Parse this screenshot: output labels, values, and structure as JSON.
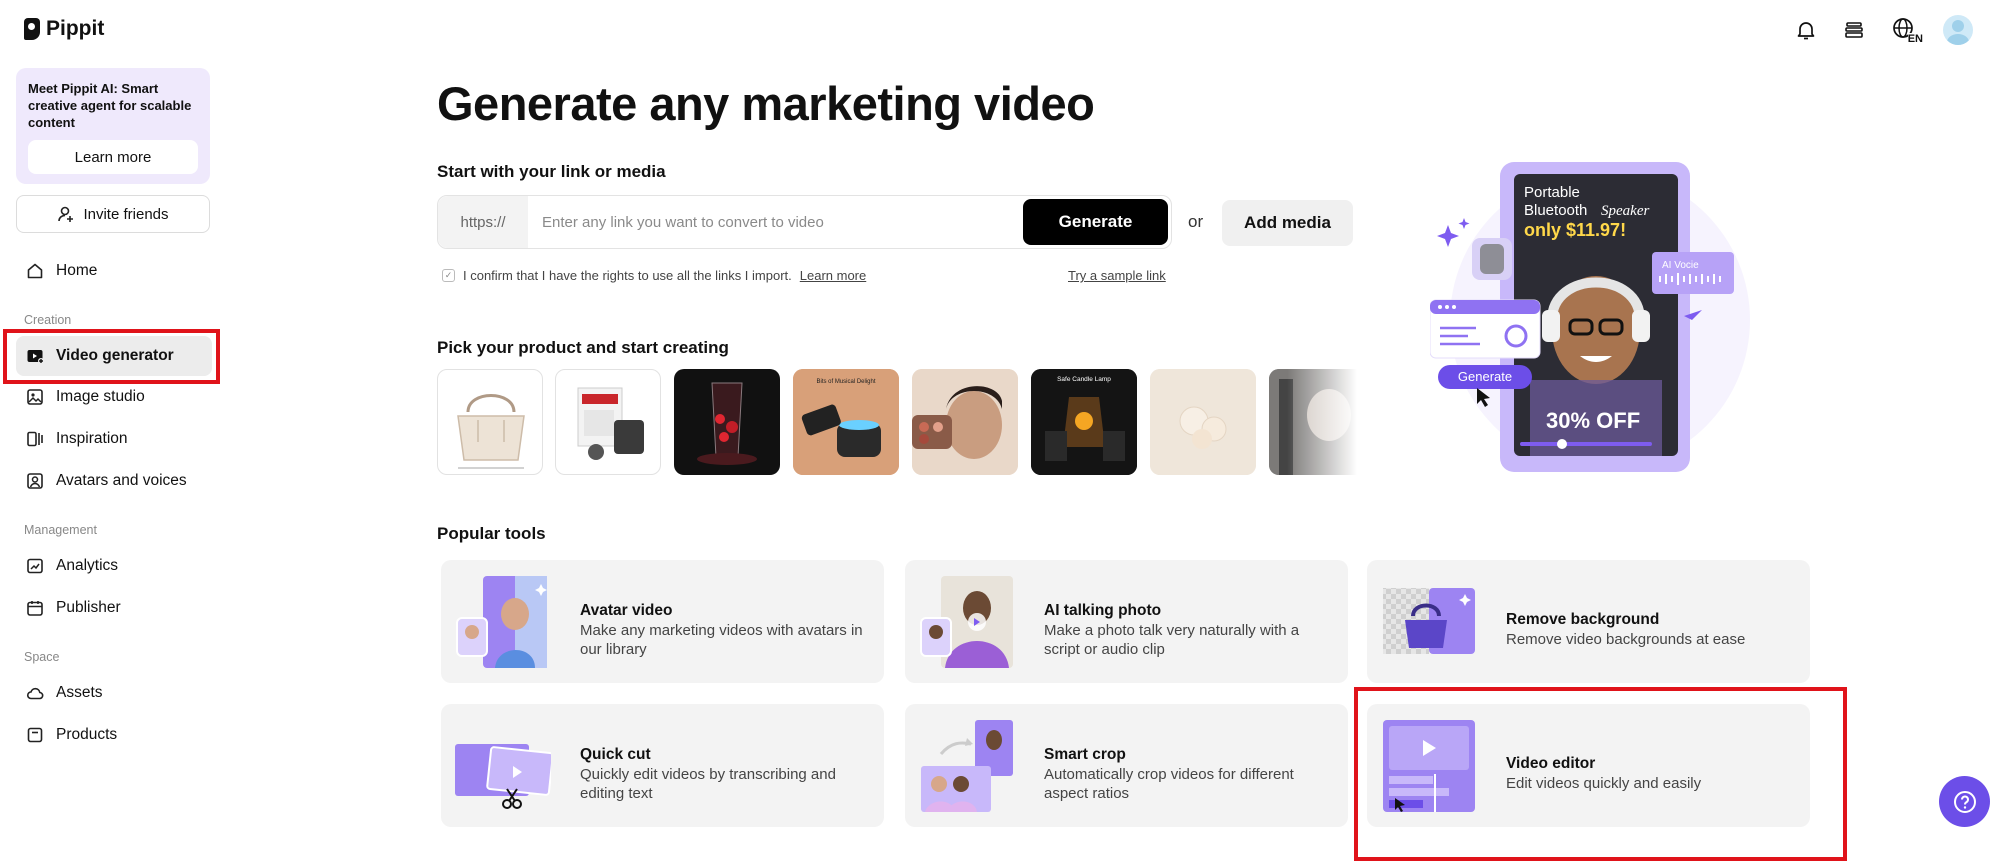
{
  "brand": {
    "name": "Pippit"
  },
  "promo": {
    "text": "Meet Pippit AI: Smart creative agent for scalable content",
    "button": "Learn more"
  },
  "invite": {
    "label": "Invite friends"
  },
  "nav": {
    "home": "Home",
    "section_creation": "Creation",
    "video_generator": "Video generator",
    "image_studio": "Image studio",
    "inspiration": "Inspiration",
    "avatars_voices": "Avatars and voices",
    "section_management": "Management",
    "analytics": "Analytics",
    "publisher": "Publisher",
    "section_space": "Space",
    "assets": "Assets",
    "products": "Products"
  },
  "topbar": {
    "language": "EN"
  },
  "main": {
    "title": "Generate any marketing video",
    "link_section_label": "Start with your link or media",
    "link_prefix": "https://",
    "link_placeholder": "Enter any link you want to convert to video",
    "link_value": "",
    "generate_button": "Generate",
    "or_text": "or",
    "add_media_button": "Add media",
    "confirm_text": "I confirm that I have the rights to use all the links I import.",
    "confirm_link": "Learn more",
    "sample_link": "Try a sample link",
    "product_section_label": "Pick your product and start creating",
    "tools_section_label": "Popular tools"
  },
  "thumb_captions": {
    "t4": "Bits of Musical Delight",
    "t7": "Safe Candle Lamp"
  },
  "hero": {
    "line1": "Portable",
    "line2a": "Bluetooth",
    "line2b": "Speaker",
    "price": "only $11.97!",
    "discount": "30% OFF",
    "ai_voice_tag": "AI Vocie",
    "generate_chip": "Generate"
  },
  "tools": [
    {
      "title": "Avatar video",
      "desc": "Make any marketing videos with avatars in our library"
    },
    {
      "title": "AI talking photo",
      "desc": "Make a photo talk very naturally with a script or audio clip"
    },
    {
      "title": "Remove background",
      "desc": "Remove video backgrounds at ease"
    },
    {
      "title": "Quick cut",
      "desc": "Quickly edit videos by transcribing and editing text"
    },
    {
      "title": "Smart crop",
      "desc": "Automatically crop videos for different aspect ratios"
    },
    {
      "title": "Video editor",
      "desc": "Edit videos quickly and easily"
    }
  ],
  "colors": {
    "accent": "#7e5cf0",
    "highlight": "#e0131a",
    "promo_bg": "#efe9fc"
  }
}
